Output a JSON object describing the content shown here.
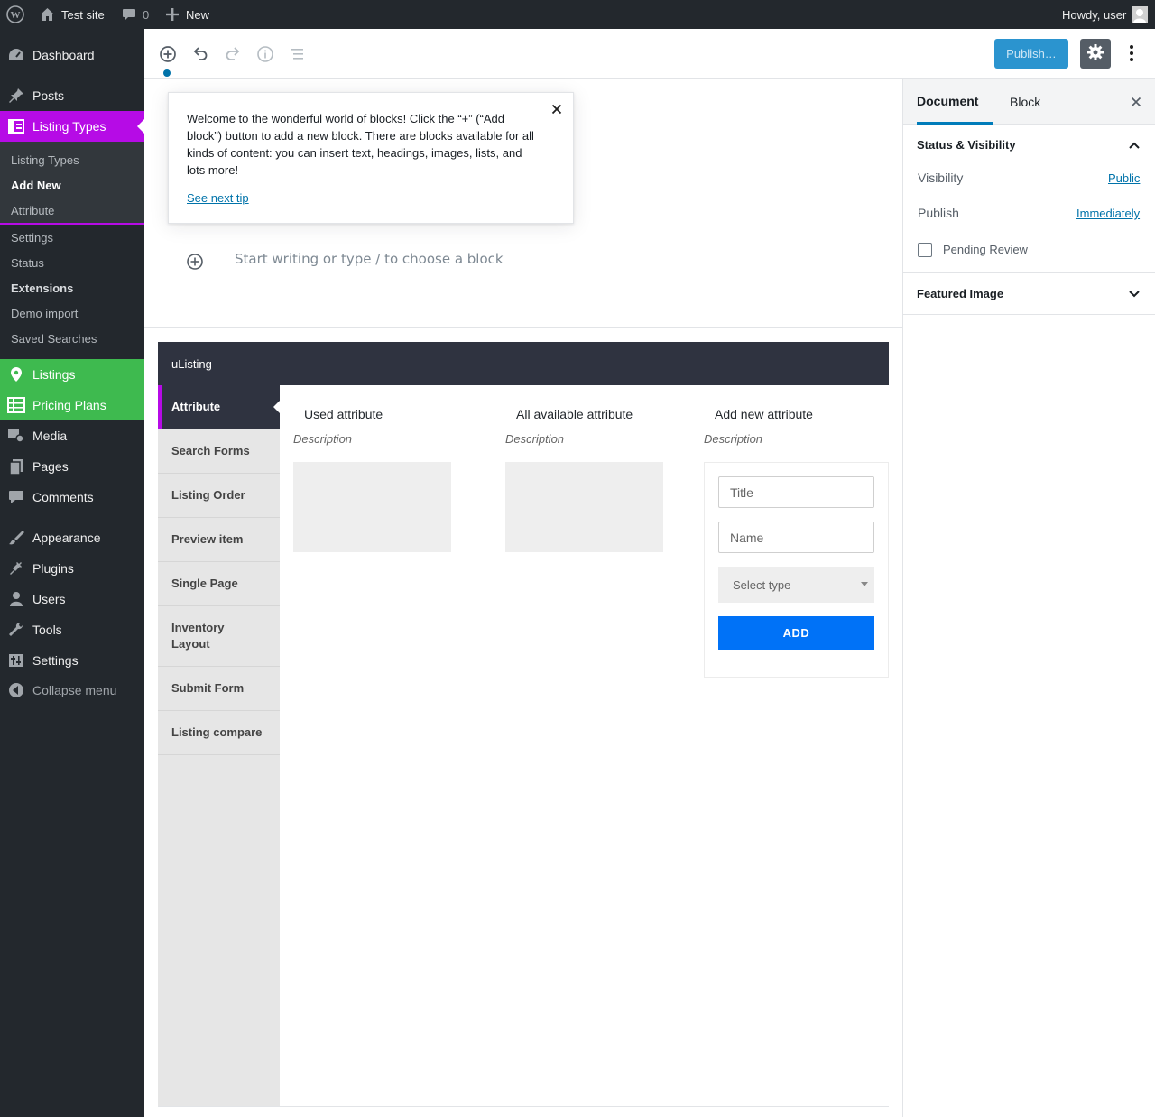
{
  "adminbar": {
    "site_name": "Test site",
    "comments_count": "0",
    "new_label": "New",
    "howdy": "Howdy, user"
  },
  "menu": {
    "dashboard": "Dashboard",
    "posts": "Posts",
    "listing_types": "Listing Types",
    "submenu": {
      "listing_types": "Listing Types",
      "add_new": "Add New",
      "attribute": "Attribute",
      "settings": "Settings",
      "status": "Status",
      "extensions": "Extensions",
      "demo_import": "Demo import",
      "saved_searches": "Saved Searches"
    },
    "listings": "Listings",
    "pricing_plans": "Pricing Plans",
    "media": "Media",
    "pages": "Pages",
    "comments": "Comments",
    "appearance": "Appearance",
    "plugins": "Plugins",
    "users": "Users",
    "tools": "Tools",
    "settings": "Settings",
    "collapse": "Collapse menu"
  },
  "toolbar": {
    "publish_label": "Publish…"
  },
  "tip": {
    "text": "Welcome to the wonderful world of blocks! Click the “+” (“Add block”) button to add a new block. There are blocks available for all kinds of content: you can insert text, headings, images, lists, and lots more!",
    "link": "See next tip"
  },
  "editor": {
    "placeholder": "Start writing or type / to choose a block"
  },
  "ulisting": {
    "title": "uListing",
    "tabs": [
      "Attribute",
      "Search Forms",
      "Listing Order",
      "Preview item",
      "Single Page",
      "Inventory Layout",
      "Submit Form",
      "Listing compare"
    ],
    "columns": {
      "used": "Used attribute",
      "available": "All available attribute",
      "add_new": "Add new attribute",
      "description": "Description"
    },
    "form": {
      "title_placeholder": "Title",
      "name_placeholder": "Name",
      "select_type": "Select type",
      "add_button": "ADD"
    }
  },
  "sidebar": {
    "tab_document": "Document",
    "tab_block": "Block",
    "status_visibility": "Status & Visibility",
    "visibility_label": "Visibility",
    "visibility_value": "Public",
    "publish_label": "Publish",
    "publish_value": "Immediately",
    "pending_review": "Pending Review",
    "featured_image": "Featured Image"
  },
  "colors": {
    "accent_purple": "#b60be6",
    "accent_green": "#3eba4f",
    "admin_dark": "#23282d",
    "link_blue": "#0073aa",
    "add_button": "#0072f7"
  }
}
